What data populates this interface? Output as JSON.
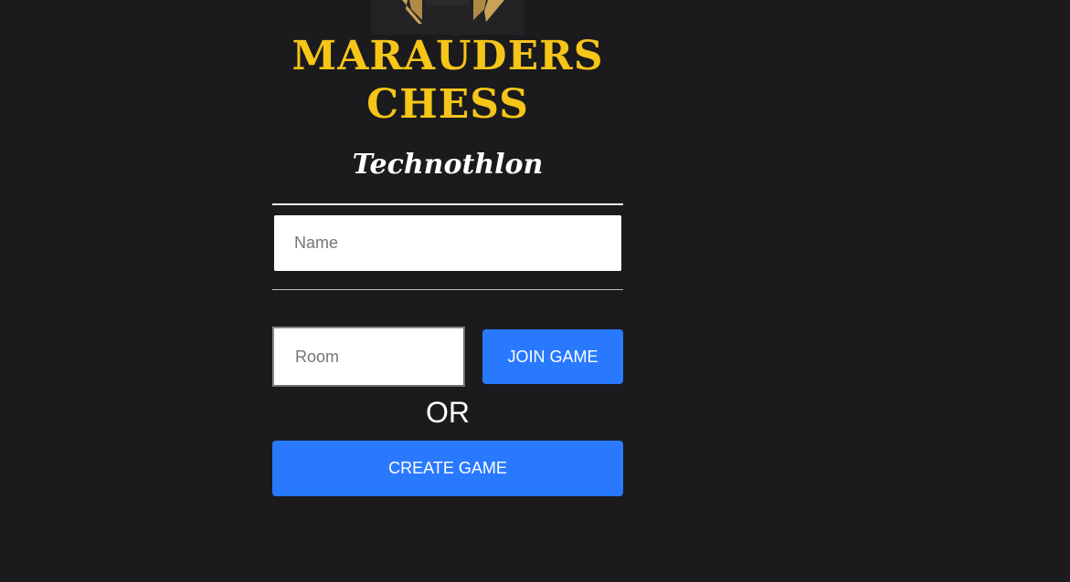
{
  "logo": {
    "icon": "chess-crown-emblem-icon",
    "title_line1": "MARAUDERS",
    "title_line2": "CHESS"
  },
  "subtitle": "Technothlon",
  "form": {
    "name_placeholder": "Name",
    "room_placeholder": "Room",
    "join_label": "JOIN GAME",
    "or_label": "OR",
    "create_label": "CREATE GAME"
  },
  "colors": {
    "background": "#1b1b1d",
    "title_yellow": "#f5c518",
    "button_blue": "#2979ff"
  }
}
